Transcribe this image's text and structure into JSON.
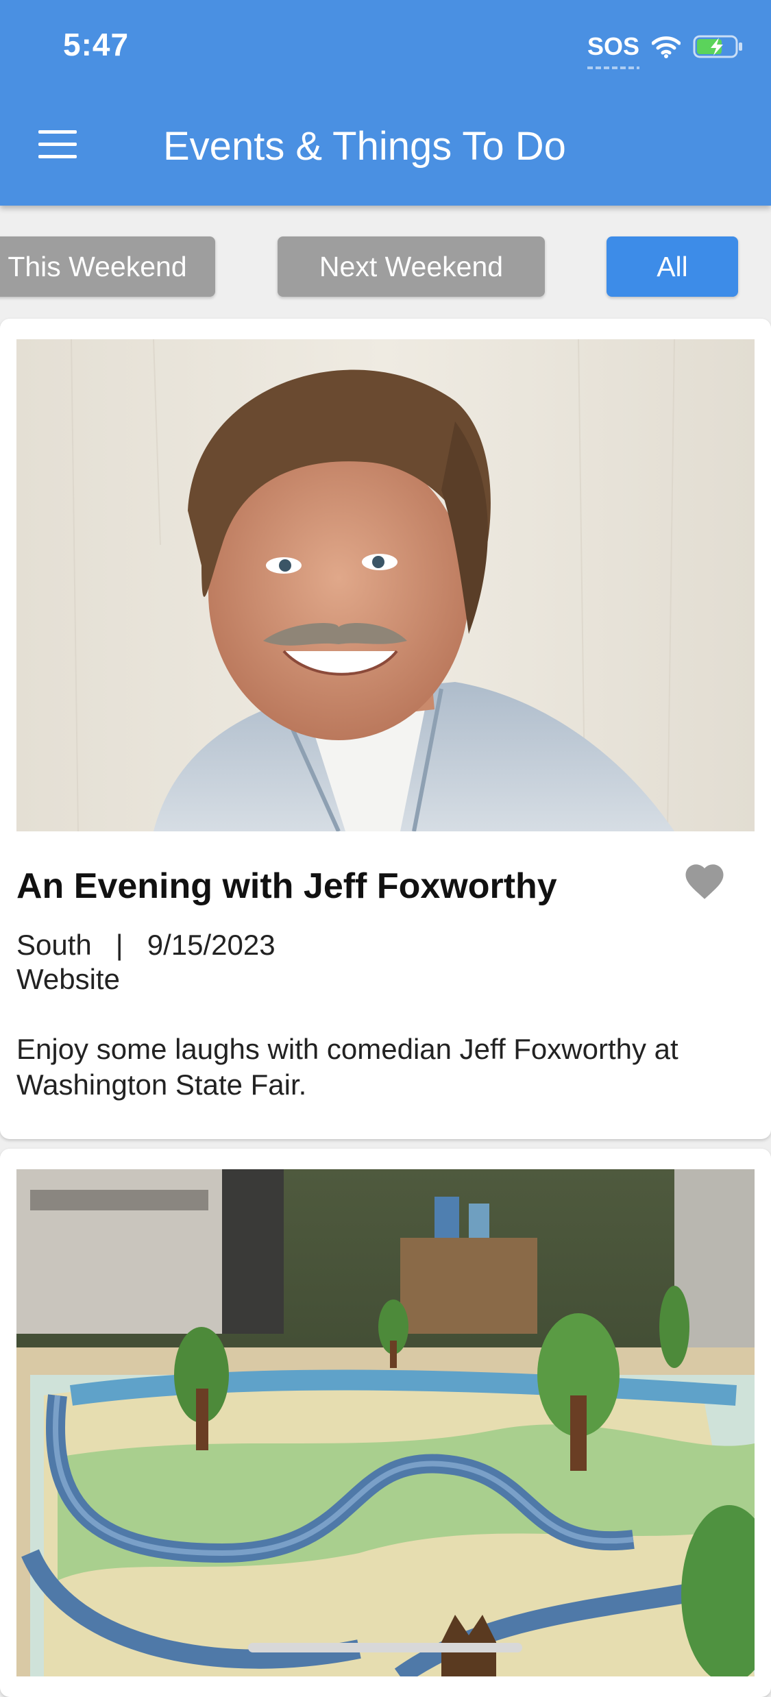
{
  "status_bar": {
    "time": "5:47",
    "sos": "SOS"
  },
  "header": {
    "title": "Events & Things To Do",
    "menu_icon": "hamburger-menu-icon"
  },
  "filters": [
    {
      "label": "This Weekend",
      "active": false
    },
    {
      "label": "Next Weekend",
      "active": false
    },
    {
      "label": "All",
      "active": true
    }
  ],
  "events": [
    {
      "title": "An Evening with Jeff Foxworthy",
      "region": "South",
      "separator": "|",
      "date": "9/15/2023",
      "link": "Website",
      "description": "Enjoy some laughs with comedian Jeff Foxworthy at Washington State Fair.",
      "favorite_icon": "heart-icon"
    },
    {
      "image": "wooden-train-map-photo"
    }
  ],
  "colors": {
    "header_bg": "#4a90e2",
    "chip_inactive": "#9e9e9e",
    "chip_active": "#3d8ce8",
    "heart": "#9a9a9a"
  }
}
